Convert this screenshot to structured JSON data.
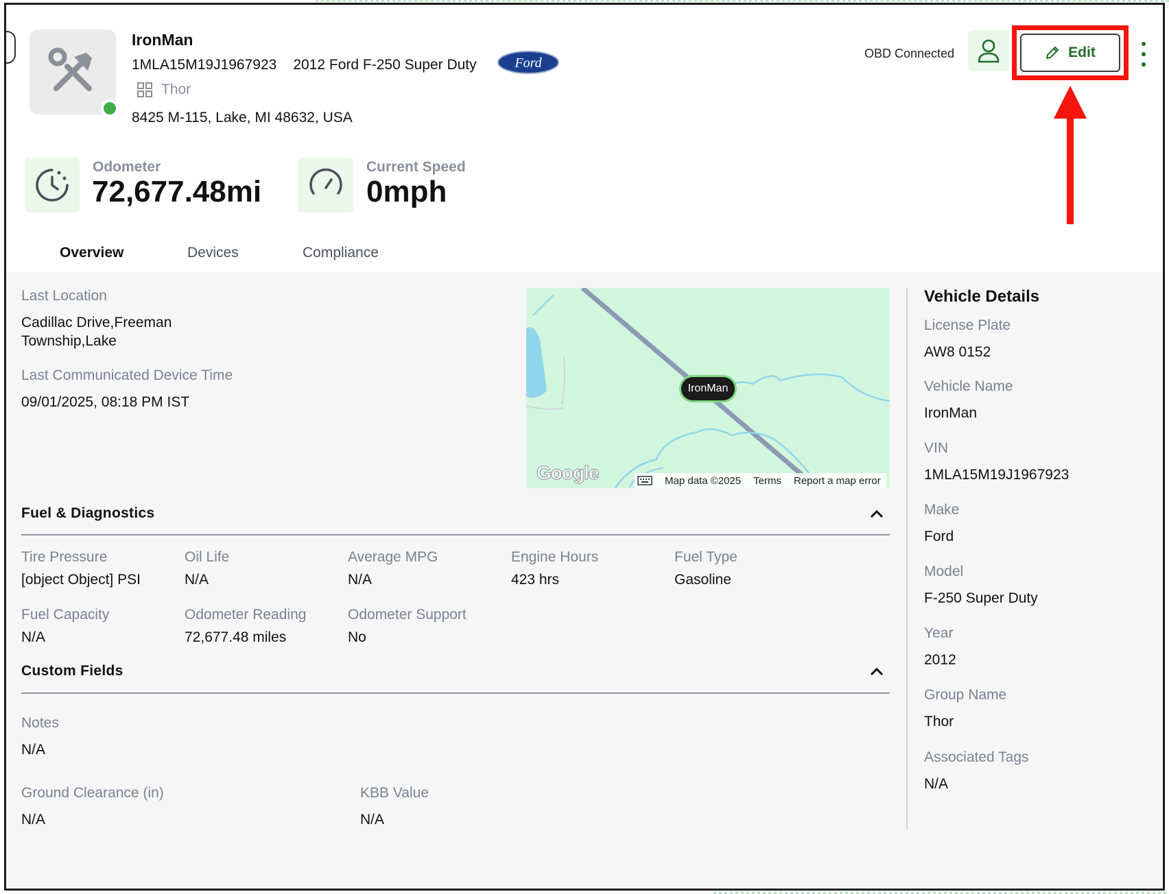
{
  "vehicle": {
    "name": "IronMan",
    "vin": "1MLA15M19J1967923",
    "description": "2012 Ford F-250 Super Duty",
    "brand_logo_text": "Ford",
    "group": "Thor",
    "address": "8425 M-115, Lake, MI 48632, USA",
    "status_color": "#3fae49"
  },
  "header_actions": {
    "obd_status": "OBD Connected",
    "edit_label": "Edit",
    "accent_color": "#1f6d2a",
    "highlight_color": "#f5150c"
  },
  "stats": {
    "odometer_label": "Odometer",
    "odometer_value": "72,677.48mi",
    "speed_label": "Current Speed",
    "speed_value": "0mph"
  },
  "tabs": [
    {
      "label": "Overview",
      "active": true
    },
    {
      "label": "Devices",
      "active": false
    },
    {
      "label": "Compliance",
      "active": false
    }
  ],
  "location": {
    "last_location_label": "Last Location",
    "last_location_line1": "Cadillac Drive,Freeman",
    "last_location_line2": "Township,Lake",
    "device_time_label": "Last Communicated Device Time",
    "device_time_value": "09/01/2025, 08:18 PM IST"
  },
  "map": {
    "pin_label": "IronMan",
    "google_text": "Google",
    "map_data": "Map data ©2025",
    "terms": "Terms",
    "report": "Report a map error"
  },
  "fuel": {
    "title": "Fuel & Diagnostics",
    "fields": [
      {
        "label": "Tire Pressure",
        "value": "[object Object] PSI"
      },
      {
        "label": "Oil Life",
        "value": "N/A"
      },
      {
        "label": "Average MPG",
        "value": "N/A"
      },
      {
        "label": "Engine Hours",
        "value": "423 hrs"
      },
      {
        "label": "Fuel Type",
        "value": "Gasoline"
      },
      {
        "label": "Fuel Capacity",
        "value": "N/A"
      },
      {
        "label": "Odometer Reading",
        "value": "72,677.48 miles"
      },
      {
        "label": "Odometer Support",
        "value": "No"
      }
    ]
  },
  "custom": {
    "title": "Custom Fields",
    "fields": [
      {
        "label": "Notes",
        "value": "N/A"
      },
      {
        "label": "Ground Clearance (in)",
        "value": "N/A"
      },
      {
        "label": "KBB Value",
        "value": "N/A"
      }
    ]
  },
  "details": {
    "title": "Vehicle Details",
    "fields": [
      {
        "label": "License Plate",
        "value": "AW8 0152"
      },
      {
        "label": "Vehicle Name",
        "value": "IronMan"
      },
      {
        "label": "VIN",
        "value": "1MLA15M19J1967923"
      },
      {
        "label": "Make",
        "value": "Ford"
      },
      {
        "label": "Model",
        "value": "F-250 Super Duty"
      },
      {
        "label": "Year",
        "value": "2012"
      },
      {
        "label": "Group Name",
        "value": "Thor"
      },
      {
        "label": "Associated Tags",
        "value": "N/A"
      }
    ]
  }
}
